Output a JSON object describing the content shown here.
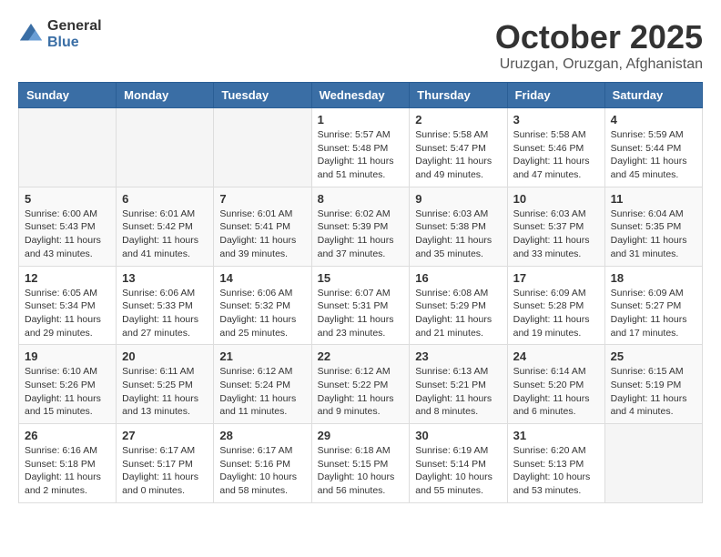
{
  "header": {
    "logo": {
      "general": "General",
      "blue": "Blue"
    },
    "title": "October 2025",
    "location": "Uruzgan, Oruzgan, Afghanistan"
  },
  "calendar": {
    "days_of_week": [
      "Sunday",
      "Monday",
      "Tuesday",
      "Wednesday",
      "Thursday",
      "Friday",
      "Saturday"
    ],
    "weeks": [
      [
        {
          "day": "",
          "info": ""
        },
        {
          "day": "",
          "info": ""
        },
        {
          "day": "",
          "info": ""
        },
        {
          "day": "1",
          "info": "Sunrise: 5:57 AM\nSunset: 5:48 PM\nDaylight: 11 hours\nand 51 minutes."
        },
        {
          "day": "2",
          "info": "Sunrise: 5:58 AM\nSunset: 5:47 PM\nDaylight: 11 hours\nand 49 minutes."
        },
        {
          "day": "3",
          "info": "Sunrise: 5:58 AM\nSunset: 5:46 PM\nDaylight: 11 hours\nand 47 minutes."
        },
        {
          "day": "4",
          "info": "Sunrise: 5:59 AM\nSunset: 5:44 PM\nDaylight: 11 hours\nand 45 minutes."
        }
      ],
      [
        {
          "day": "5",
          "info": "Sunrise: 6:00 AM\nSunset: 5:43 PM\nDaylight: 11 hours\nand 43 minutes."
        },
        {
          "day": "6",
          "info": "Sunrise: 6:01 AM\nSunset: 5:42 PM\nDaylight: 11 hours\nand 41 minutes."
        },
        {
          "day": "7",
          "info": "Sunrise: 6:01 AM\nSunset: 5:41 PM\nDaylight: 11 hours\nand 39 minutes."
        },
        {
          "day": "8",
          "info": "Sunrise: 6:02 AM\nSunset: 5:39 PM\nDaylight: 11 hours\nand 37 minutes."
        },
        {
          "day": "9",
          "info": "Sunrise: 6:03 AM\nSunset: 5:38 PM\nDaylight: 11 hours\nand 35 minutes."
        },
        {
          "day": "10",
          "info": "Sunrise: 6:03 AM\nSunset: 5:37 PM\nDaylight: 11 hours\nand 33 minutes."
        },
        {
          "day": "11",
          "info": "Sunrise: 6:04 AM\nSunset: 5:35 PM\nDaylight: 11 hours\nand 31 minutes."
        }
      ],
      [
        {
          "day": "12",
          "info": "Sunrise: 6:05 AM\nSunset: 5:34 PM\nDaylight: 11 hours\nand 29 minutes."
        },
        {
          "day": "13",
          "info": "Sunrise: 6:06 AM\nSunset: 5:33 PM\nDaylight: 11 hours\nand 27 minutes."
        },
        {
          "day": "14",
          "info": "Sunrise: 6:06 AM\nSunset: 5:32 PM\nDaylight: 11 hours\nand 25 minutes."
        },
        {
          "day": "15",
          "info": "Sunrise: 6:07 AM\nSunset: 5:31 PM\nDaylight: 11 hours\nand 23 minutes."
        },
        {
          "day": "16",
          "info": "Sunrise: 6:08 AM\nSunset: 5:29 PM\nDaylight: 11 hours\nand 21 minutes."
        },
        {
          "day": "17",
          "info": "Sunrise: 6:09 AM\nSunset: 5:28 PM\nDaylight: 11 hours\nand 19 minutes."
        },
        {
          "day": "18",
          "info": "Sunrise: 6:09 AM\nSunset: 5:27 PM\nDaylight: 11 hours\nand 17 minutes."
        }
      ],
      [
        {
          "day": "19",
          "info": "Sunrise: 6:10 AM\nSunset: 5:26 PM\nDaylight: 11 hours\nand 15 minutes."
        },
        {
          "day": "20",
          "info": "Sunrise: 6:11 AM\nSunset: 5:25 PM\nDaylight: 11 hours\nand 13 minutes."
        },
        {
          "day": "21",
          "info": "Sunrise: 6:12 AM\nSunset: 5:24 PM\nDaylight: 11 hours\nand 11 minutes."
        },
        {
          "day": "22",
          "info": "Sunrise: 6:12 AM\nSunset: 5:22 PM\nDaylight: 11 hours\nand 9 minutes."
        },
        {
          "day": "23",
          "info": "Sunrise: 6:13 AM\nSunset: 5:21 PM\nDaylight: 11 hours\nand 8 minutes."
        },
        {
          "day": "24",
          "info": "Sunrise: 6:14 AM\nSunset: 5:20 PM\nDaylight: 11 hours\nand 6 minutes."
        },
        {
          "day": "25",
          "info": "Sunrise: 6:15 AM\nSunset: 5:19 PM\nDaylight: 11 hours\nand 4 minutes."
        }
      ],
      [
        {
          "day": "26",
          "info": "Sunrise: 6:16 AM\nSunset: 5:18 PM\nDaylight: 11 hours\nand 2 minutes."
        },
        {
          "day": "27",
          "info": "Sunrise: 6:17 AM\nSunset: 5:17 PM\nDaylight: 11 hours\nand 0 minutes."
        },
        {
          "day": "28",
          "info": "Sunrise: 6:17 AM\nSunset: 5:16 PM\nDaylight: 10 hours\nand 58 minutes."
        },
        {
          "day": "29",
          "info": "Sunrise: 6:18 AM\nSunset: 5:15 PM\nDaylight: 10 hours\nand 56 minutes."
        },
        {
          "day": "30",
          "info": "Sunrise: 6:19 AM\nSunset: 5:14 PM\nDaylight: 10 hours\nand 55 minutes."
        },
        {
          "day": "31",
          "info": "Sunrise: 6:20 AM\nSunset: 5:13 PM\nDaylight: 10 hours\nand 53 minutes."
        },
        {
          "day": "",
          "info": ""
        }
      ]
    ]
  }
}
